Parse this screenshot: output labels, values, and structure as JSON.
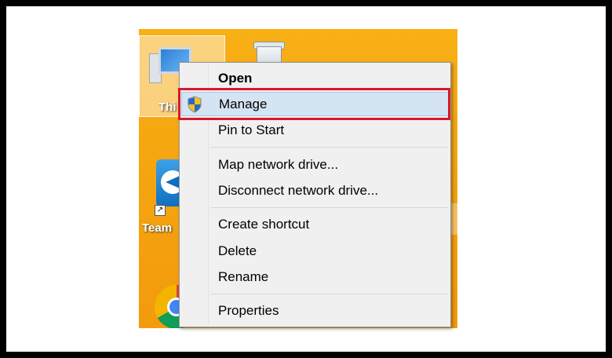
{
  "desktop": {
    "icons": [
      {
        "name": "this-pc",
        "label": "Thi"
      },
      {
        "name": "recycle-bin",
        "label": ""
      },
      {
        "name": "teamviewer",
        "label": "Team"
      },
      {
        "name": "chrome",
        "label": ""
      }
    ]
  },
  "context_menu": {
    "items": [
      {
        "label": "Open",
        "bold": true
      },
      {
        "label": "Manage",
        "icon": "uac-shield-icon",
        "highlighted": true
      },
      {
        "label": "Pin to Start"
      },
      {
        "label": "Map network drive..."
      },
      {
        "label": "Disconnect network drive..."
      },
      {
        "label": "Create shortcut"
      },
      {
        "label": "Delete"
      },
      {
        "label": "Rename"
      },
      {
        "label": "Properties"
      }
    ]
  },
  "colors": {
    "desktop": "#f6a911",
    "menu_bg": "#f0f0f0",
    "hover": "#d5e4f2",
    "annotation_box": "#d7192c"
  }
}
